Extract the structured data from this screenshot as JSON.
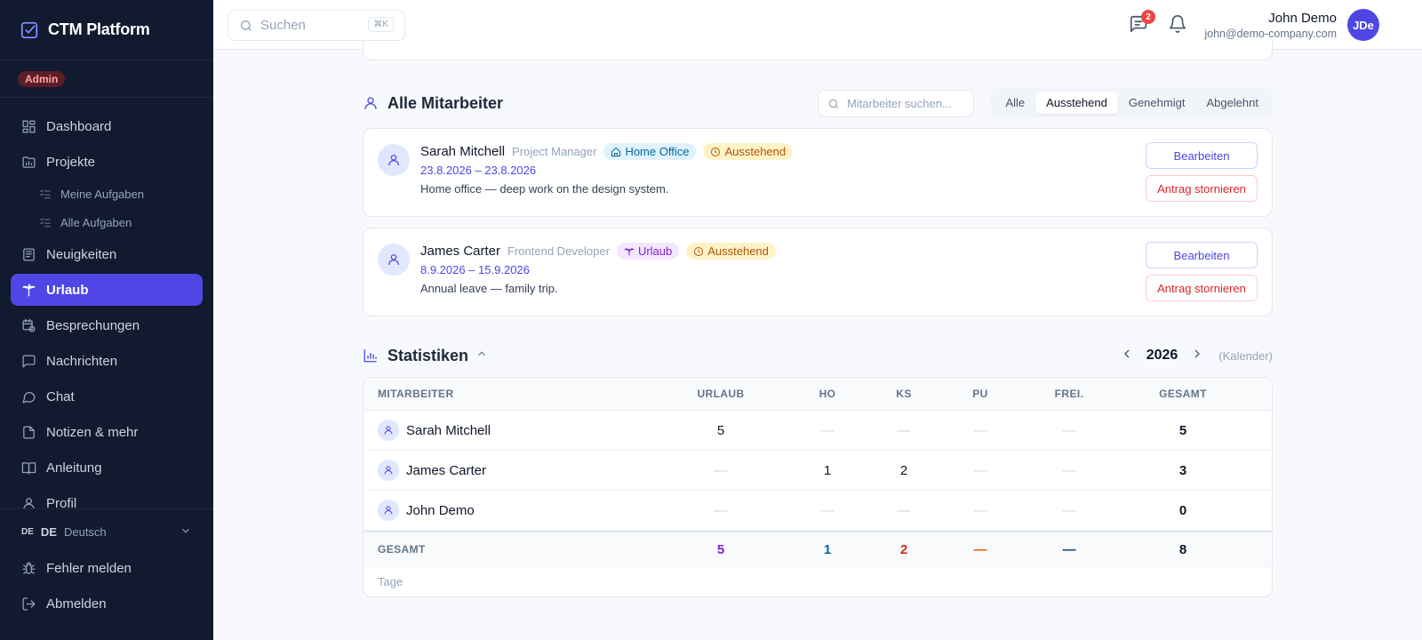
{
  "app": {
    "brand": "CTM Platform",
    "role_badge": "Admin"
  },
  "sidebar": {
    "items": [
      {
        "label": "Dashboard",
        "icon": "dashboard-icon"
      },
      {
        "label": "Projekte",
        "icon": "folder-chart-icon"
      },
      {
        "label": "Meine Aufgaben",
        "icon": "list-check-icon",
        "sub": true
      },
      {
        "label": "Alle Aufgaben",
        "icon": "list-check-icon",
        "sub": true
      },
      {
        "label": "Neuigkeiten",
        "icon": "newspaper-icon"
      },
      {
        "label": "Urlaub",
        "icon": "palm-tree-icon",
        "active": true
      },
      {
        "label": "Besprechungen",
        "icon": "calendar-clock-icon"
      },
      {
        "label": "Nachrichten",
        "icon": "message-square-icon"
      },
      {
        "label": "Chat",
        "icon": "message-circle-icon"
      },
      {
        "label": "Notizen & mehr",
        "icon": "file-icon"
      },
      {
        "label": "Anleitung",
        "icon": "book-icon"
      },
      {
        "label": "Profil",
        "icon": "user-icon"
      }
    ],
    "language": {
      "code_small": "DE",
      "code": "DE",
      "label": "Deutsch"
    },
    "report_bug": "Fehler melden",
    "logout": "Abmelden"
  },
  "topbar": {
    "search_placeholder": "Suchen",
    "search_shortcut": "⌘K",
    "messages_badge": "2",
    "user_name": "John Demo",
    "user_email": "john@demo-company.com",
    "avatar_initials": "JDe"
  },
  "employees": {
    "title": "Alle Mitarbeiter",
    "search_placeholder": "Mitarbeiter suchen...",
    "filters": [
      "Alle",
      "Ausstehend",
      "Genehmigt",
      "Abgelehnt"
    ],
    "active_filter": "Ausstehend",
    "requests": [
      {
        "name": "Sarah Mitchell",
        "role": "Project Manager",
        "type": "Home Office",
        "type_kind": "ho",
        "status": "Ausstehend",
        "dates": "23.8.2026 – 23.8.2026",
        "note": "Home office — deep work on the design system.",
        "edit_label": "Bearbeiten",
        "cancel_label": "Antrag stornieren"
      },
      {
        "name": "James Carter",
        "role": "Frontend Developer",
        "type": "Urlaub",
        "type_kind": "urlaub",
        "status": "Ausstehend",
        "dates": "8.9.2026 – 15.9.2026",
        "note": "Annual leave — family trip.",
        "edit_label": "Bearbeiten",
        "cancel_label": "Antrag stornieren"
      }
    ]
  },
  "stats": {
    "title": "Statistiken",
    "year": "2026",
    "year_note": "(Kalender)",
    "headers": [
      "MITARBEITER",
      "URLAUB",
      "HO",
      "KS",
      "PU",
      "FREI.",
      "GESAMT"
    ],
    "rows": [
      {
        "name": "Sarah Mitchell",
        "values": [
          "5",
          "—",
          "—",
          "—",
          "—",
          "5"
        ]
      },
      {
        "name": "James Carter",
        "values": [
          "—",
          "1",
          "2",
          "—",
          "—",
          "3"
        ]
      },
      {
        "name": "John Demo",
        "values": [
          "—",
          "—",
          "—",
          "—",
          "—",
          "0"
        ]
      }
    ],
    "total": {
      "label": "GESAMT",
      "values": [
        "5",
        "1",
        "2",
        "—",
        "—",
        "8"
      ]
    },
    "footer": "Tage",
    "colors": {
      "urlaub": "#7e22ce",
      "ho": "#0369a1",
      "ks": "#dc2626",
      "pu": "#ea580c",
      "frei": "#0d9488"
    }
  }
}
